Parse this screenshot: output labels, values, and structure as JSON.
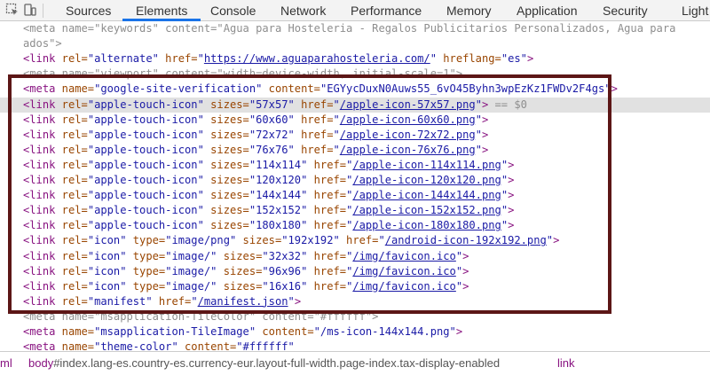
{
  "toolbar": {
    "icons": [
      "inspect-element-icon",
      "device-toolbar-icon"
    ],
    "tabs": [
      {
        "label": "Sources"
      },
      {
        "label": "Elements"
      },
      {
        "label": "Console"
      },
      {
        "label": "Network"
      },
      {
        "label": "Performance"
      },
      {
        "label": "Memory"
      },
      {
        "label": "Application"
      },
      {
        "label": "Security"
      },
      {
        "label": "Light"
      }
    ],
    "active_tab": "Elements",
    "accent": "#1a73e8"
  },
  "dom": {
    "lines": [
      {
        "tokens": [
          "<meta name=\"keywords\" content=\"Agua para Hosteleria - Regalos Publicitarios Personalizados, Agua para"
        ]
      },
      {
        "tokens": [
          "ados\">"
        ]
      },
      {
        "tokens": [
          "<link",
          " rel=",
          "\"alternate\"",
          " href=",
          "\"",
          "https://www.aguaparahosteleria.com/",
          "\"",
          " hreflang=",
          "\"es\"",
          ">"
        ]
      },
      {
        "tokens": [
          "<meta name=\"viewport\" content=\"width=device-width, initial-scale=1\">"
        ]
      },
      {
        "tokens": [
          "<meta",
          " name=",
          "\"google-site-verification\"",
          " content=",
          "\"EGYycDuxN0Auws55_6vO45Byhn3wpEzKz1FWDv2F4gs\"",
          ">"
        ]
      },
      {
        "tokens": [
          "<link",
          " rel=",
          "\"apple-touch-icon\"",
          " sizes=",
          "\"57x57\"",
          " href=",
          "\"",
          "/apple-icon-57x57.png",
          "\"",
          ">",
          " == $0"
        ]
      },
      {
        "tokens": [
          "<link",
          " rel=",
          "\"apple-touch-icon\"",
          " sizes=",
          "\"60x60\"",
          " href=",
          "\"",
          "/apple-icon-60x60.png",
          "\"",
          ">"
        ]
      },
      {
        "tokens": [
          "<link",
          " rel=",
          "\"apple-touch-icon\"",
          " sizes=",
          "\"72x72\"",
          " href=",
          "\"",
          "/apple-icon-72x72.png",
          "\"",
          ">"
        ]
      },
      {
        "tokens": [
          "<link",
          " rel=",
          "\"apple-touch-icon\"",
          " sizes=",
          "\"76x76\"",
          " href=",
          "\"",
          "/apple-icon-76x76.png",
          "\"",
          ">"
        ]
      },
      {
        "tokens": [
          "<link",
          " rel=",
          "\"apple-touch-icon\"",
          " sizes=",
          "\"114x114\"",
          " href=",
          "\"",
          "/apple-icon-114x114.png",
          "\"",
          ">"
        ]
      },
      {
        "tokens": [
          "<link",
          " rel=",
          "\"apple-touch-icon\"",
          " sizes=",
          "\"120x120\"",
          " href=",
          "\"",
          "/apple-icon-120x120.png",
          "\"",
          ">"
        ]
      },
      {
        "tokens": [
          "<link",
          " rel=",
          "\"apple-touch-icon\"",
          " sizes=",
          "\"144x144\"",
          " href=",
          "\"",
          "/apple-icon-144x144.png",
          "\"",
          ">"
        ]
      },
      {
        "tokens": [
          "<link",
          " rel=",
          "\"apple-touch-icon\"",
          " sizes=",
          "\"152x152\"",
          " href=",
          "\"",
          "/apple-icon-152x152.png",
          "\"",
          ">"
        ]
      },
      {
        "tokens": [
          "<link",
          " rel=",
          "\"apple-touch-icon\"",
          " sizes=",
          "\"180x180\"",
          " href=",
          "\"",
          "/apple-icon-180x180.png",
          "\"",
          ">"
        ]
      },
      {
        "tokens": [
          "<link",
          " rel=",
          "\"icon\"",
          " type=",
          "\"image/png\"",
          " sizes=",
          "\"192x192\"",
          " href=",
          "\"",
          "/android-icon-192x192.png",
          "\"",
          ">"
        ]
      },
      {
        "tokens": [
          "<link",
          " rel=",
          "\"icon\"",
          " type=",
          "\"image/\"",
          " sizes=",
          "\"32x32\"",
          " href=",
          "\"",
          "/img/favicon.ico",
          "\"",
          ">"
        ]
      },
      {
        "tokens": [
          "<link",
          " rel=",
          "\"icon\"",
          " type=",
          "\"image/\"",
          " sizes=",
          "\"96x96\"",
          " href=",
          "\"",
          "/img/favicon.ico",
          "\"",
          ">"
        ]
      },
      {
        "tokens": [
          "<link",
          " rel=",
          "\"icon\"",
          " type=",
          "\"image/\"",
          " sizes=",
          "\"16x16\"",
          " href=",
          "\"",
          "/img/favicon.ico",
          "\"",
          ">"
        ]
      },
      {
        "tokens": [
          "<link",
          " rel=",
          "\"manifest\"",
          " href=",
          "\"",
          "/manifest.json",
          "\"",
          ">"
        ]
      },
      {
        "tokens": [
          "<meta name=\"msapplication-TileColor\" content=\"#ffffff\">"
        ]
      },
      {
        "tokens": [
          "<meta",
          " name=",
          "\"msapplication-TileImage\"",
          " content=",
          "\"/ms-icon-144x144.png\"",
          ">"
        ]
      },
      {
        "tokens": [
          "<meta",
          " name=",
          "\"theme-color\"",
          " content=",
          "\"#ffffff\""
        ]
      }
    ],
    "selected_line": 5
  },
  "breadcrumbs": [
    {
      "text": "ml"
    },
    {
      "text": "body#index.lang-es.country-es.currency-eur.layout-full-width.page-index.tax-display-enabled"
    },
    {
      "text": "link"
    }
  ],
  "colors": {
    "tag": "#881280",
    "attr_name": "#994500",
    "attr_value": "#1a1aa6",
    "highlight_box": "#5c1616",
    "selection": "#e1e1e1"
  }
}
